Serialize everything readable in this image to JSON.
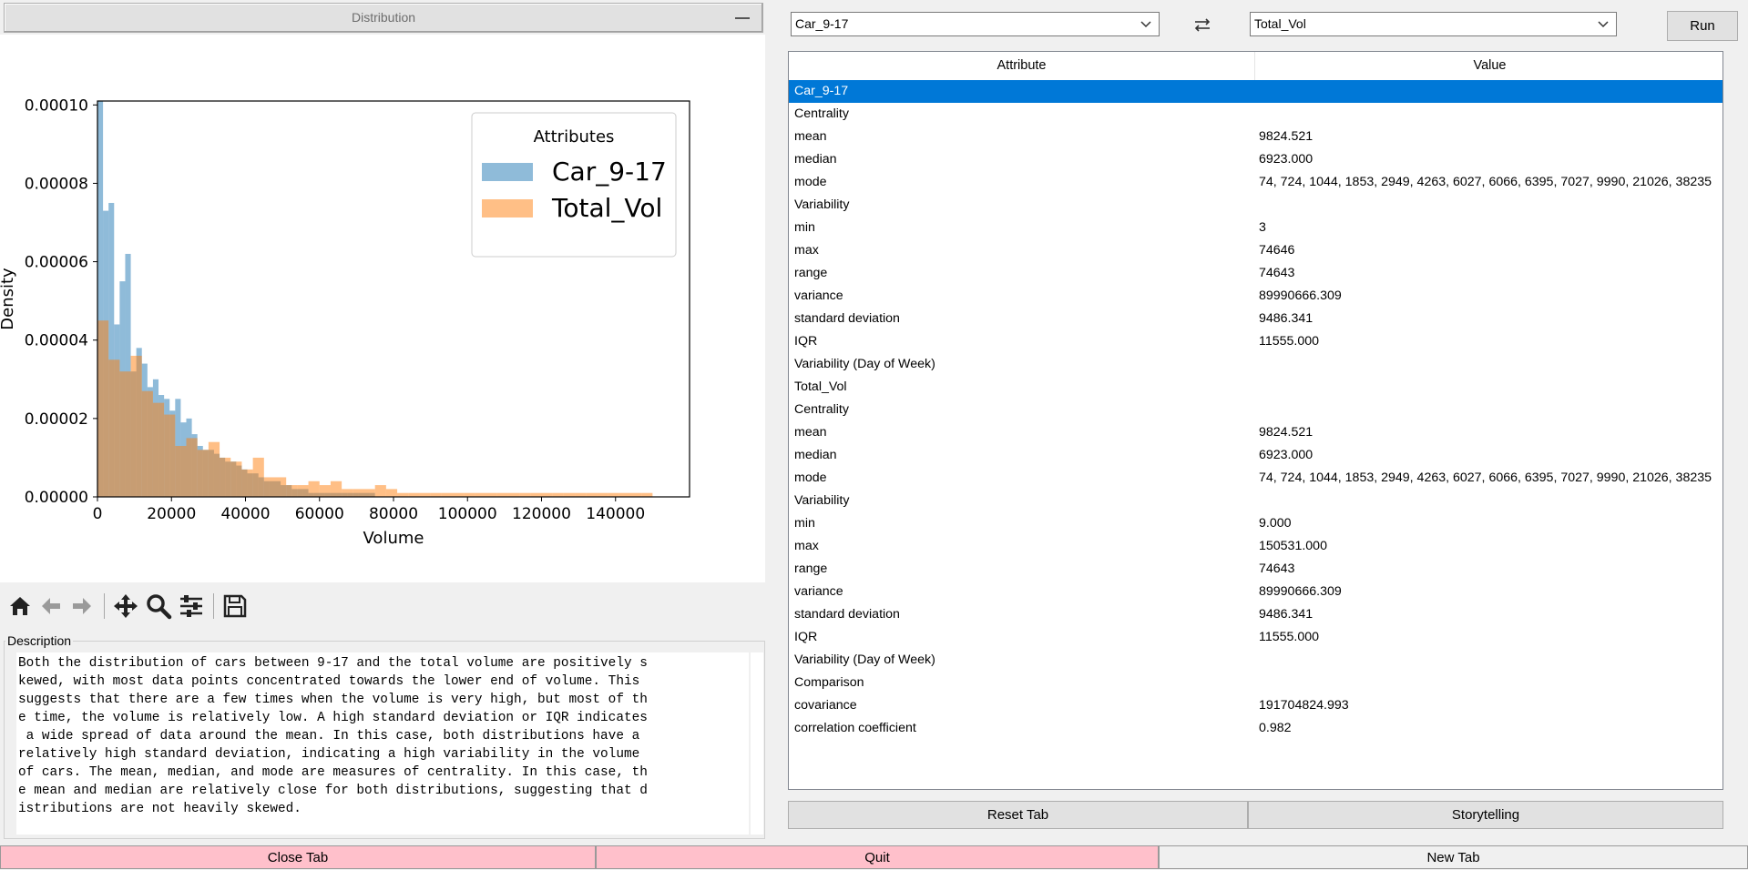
{
  "left": {
    "section_title": "Distribution",
    "description_label": "Description",
    "description_lines": [
      "Both the distribution of cars between 9-17 and the total volume are positively s",
      "kewed, with most data points concentrated towards the lower end of volume. This",
      "suggests that there are a few times when the volume is very high, but most of th",
      "e time, the volume is relatively low. A high standard deviation or IQR indicates",
      " a wide spread of data around the mean. In this case, both distributions have a",
      "relatively high standard deviation, indicating a high variability in the volume",
      "of cars. The mean, median, and mode are measures of centrality. In this case, th",
      "e mean and median are relatively close for both distributions, suggesting that d",
      "istributions are not heavily skewed."
    ],
    "toolbar_icons": [
      "home-icon",
      "back-arrow-icon",
      "forward-arrow-icon",
      "pan-icon",
      "zoom-icon",
      "configure-subplots-icon",
      "save-icon"
    ]
  },
  "controls": {
    "attribute1": "Car_9-17",
    "attribute2": "Total_Vol",
    "run_label": "Run",
    "swap_icon": "swap-icon"
  },
  "table": {
    "headers": [
      "Attribute",
      "Value"
    ],
    "selected_row": 0,
    "rows": [
      [
        "Car_9-17",
        ""
      ],
      [
        "Centrality",
        ""
      ],
      [
        "mean",
        "9824.521"
      ],
      [
        "median",
        "6923.000"
      ],
      [
        "mode",
        "74, 724, 1044, 1853, 2949, 4263, 6027, 6066, 6395, 7027, 9990, 21026, 38235"
      ],
      [
        "Variability",
        ""
      ],
      [
        "min",
        "3"
      ],
      [
        "max",
        "74646"
      ],
      [
        "range",
        "74643"
      ],
      [
        "variance",
        "89990666.309"
      ],
      [
        "standard deviation",
        "9486.341"
      ],
      [
        "IQR",
        "11555.000"
      ],
      [
        "Variability (Day of Week)",
        ""
      ],
      [
        "Total_Vol",
        ""
      ],
      [
        "Centrality",
        ""
      ],
      [
        "mean",
        "9824.521"
      ],
      [
        "median",
        "6923.000"
      ],
      [
        "mode",
        "74, 724, 1044, 1853, 2949, 4263, 6027, 6066, 6395, 7027, 9990, 21026, 38235"
      ],
      [
        "Variability",
        ""
      ],
      [
        "min",
        "9.000"
      ],
      [
        "max",
        "150531.000"
      ],
      [
        "range",
        "74643"
      ],
      [
        "variance",
        "89990666.309"
      ],
      [
        "standard deviation",
        "9486.341"
      ],
      [
        "IQR",
        "11555.000"
      ],
      [
        "Variability (Day of Week)",
        ""
      ],
      [
        "Comparison",
        ""
      ],
      [
        "covariance",
        "191704824.993"
      ],
      [
        "correlation coefficient",
        "0.982"
      ]
    ]
  },
  "buttons": {
    "reset_tab": "Reset Tab",
    "storytelling": "Storytelling",
    "close_tab": "Close Tab",
    "quit": "Quit",
    "new_tab": "New Tab"
  },
  "colors": {
    "car_series": "#1f77b4",
    "total_series": "#ff7f0e",
    "selection": "#0078d7",
    "pink_button": "#ffc0cb"
  },
  "chart_data": {
    "type": "bar",
    "title": "",
    "xlabel": "Volume",
    "ylabel": "Density",
    "xlim": [
      0,
      160000
    ],
    "ylim": [
      0,
      0.000101
    ],
    "xticks": [
      0,
      20000,
      40000,
      60000,
      80000,
      100000,
      120000,
      140000
    ],
    "xtick_labels": [
      "0",
      "20000",
      "40000",
      "60000",
      "80000",
      "100000",
      "120000",
      "140000"
    ],
    "yticks": [
      0,
      2e-05,
      4e-05,
      6e-05,
      8e-05,
      0.0001
    ],
    "ytick_labels": [
      "0.00000",
      "0.00002",
      "0.00004",
      "0.00006",
      "0.00008",
      "0.00010"
    ],
    "legend_title": "Attributes",
    "legend_position": "upper right",
    "series": [
      {
        "name": "Car_9-17",
        "bin_width": 1500,
        "x_start": 0,
        "alpha": 0.5,
        "values": [
          0.000101,
          7.3e-05,
          7.5e-05,
          4.4e-05,
          5.5e-05,
          6.2e-05,
          3.2e-05,
          3.8e-05,
          3.4e-05,
          2.8e-05,
          3e-05,
          2.6e-05,
          2.5e-05,
          2.2e-05,
          2.5e-05,
          1.9e-05,
          2e-05,
          1.6e-05,
          1.3e-05,
          1.2e-05,
          1.2e-05,
          1.1e-05,
          1e-05,
          9e-06,
          9e-06,
          8e-06,
          7e-06,
          6e-06,
          6e-06,
          5e-06,
          4e-06,
          4e-06,
          4e-06,
          3e-06,
          3e-06,
          2e-06,
          2e-06,
          2e-06,
          1e-06,
          1e-06,
          1e-06,
          1e-06,
          1e-06,
          1e-06,
          1e-06,
          1e-06,
          1e-06,
          1e-06,
          1e-06,
          1e-06
        ]
      },
      {
        "name": "Total_Vol",
        "bin_width": 3000,
        "x_start": 0,
        "alpha": 0.5,
        "values": [
          4.5e-05,
          3.5e-05,
          3.2e-05,
          3.6e-05,
          2.7e-05,
          2.4e-05,
          2.1e-05,
          1.3e-05,
          1.5e-05,
          1.2e-05,
          1.4e-05,
          1e-05,
          9e-06,
          7e-06,
          1e-05,
          5e-06,
          5e-06,
          3e-06,
          3e-06,
          4e-06,
          3e-06,
          4e-06,
          2e-06,
          2e-06,
          2e-06,
          3e-06,
          2e-06,
          1e-06,
          1e-06,
          1e-06,
          1e-06,
          1e-06,
          1e-06,
          1e-06,
          1e-06,
          1e-06,
          1e-06,
          1e-06,
          1e-06,
          1e-06,
          1e-06,
          1e-06,
          1e-06,
          1e-06,
          1e-06,
          1e-06,
          1e-06,
          1e-06,
          1e-06,
          1e-06
        ]
      }
    ]
  }
}
